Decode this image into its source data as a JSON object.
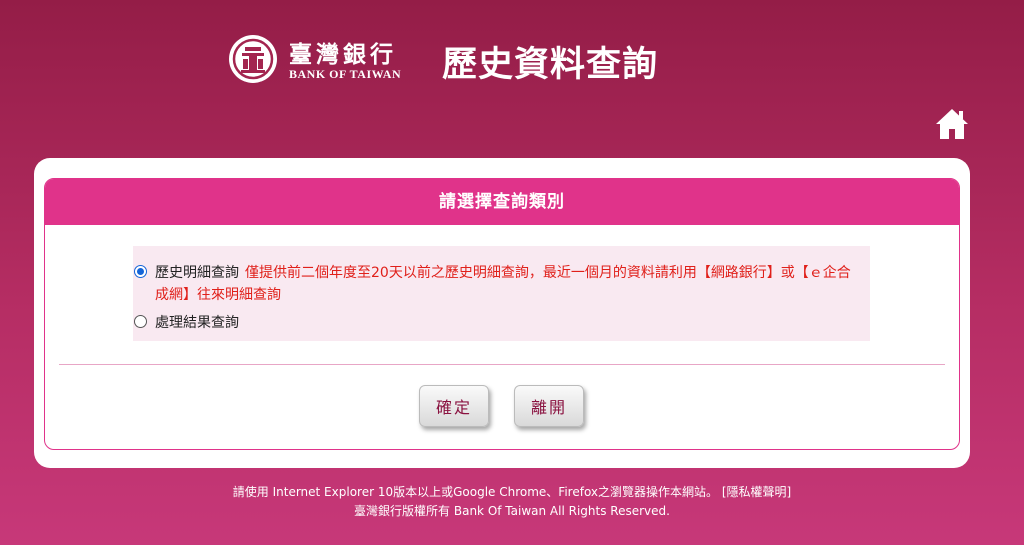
{
  "header": {
    "logo_zh": "臺灣銀行",
    "logo_en": "BANK OF TAIWAN",
    "title": "歷史資料查詢",
    "home_icon": "home-icon"
  },
  "panel": {
    "heading": "請選擇查詢類別",
    "options": [
      {
        "label": "歷史明細查詢",
        "note": "僅提供前二個年度至20天以前之歷史明細查詢，最近一個月的資料請利用【網路銀行】或【ｅ企合成網】往來明細查詢",
        "selected": true
      },
      {
        "label": "處理結果查詢",
        "selected": false
      }
    ]
  },
  "buttons": {
    "confirm": "確定",
    "exit": "離開"
  },
  "footer": {
    "line1": "請使用 Internet Explorer 10版本以上或Google Chrome、Firefox之瀏覽器操作本網站。 [隱私權聲明]",
    "line2": "臺灣銀行版權所有 Bank Of Taiwan All Rights Reserved."
  },
  "colors": {
    "background_top": "#941d47",
    "background_bottom": "#c73879",
    "panel_header": "#e0338a",
    "note_text": "#e0201a",
    "option_bg": "#f9e9f1",
    "button_text": "#8a1240"
  }
}
